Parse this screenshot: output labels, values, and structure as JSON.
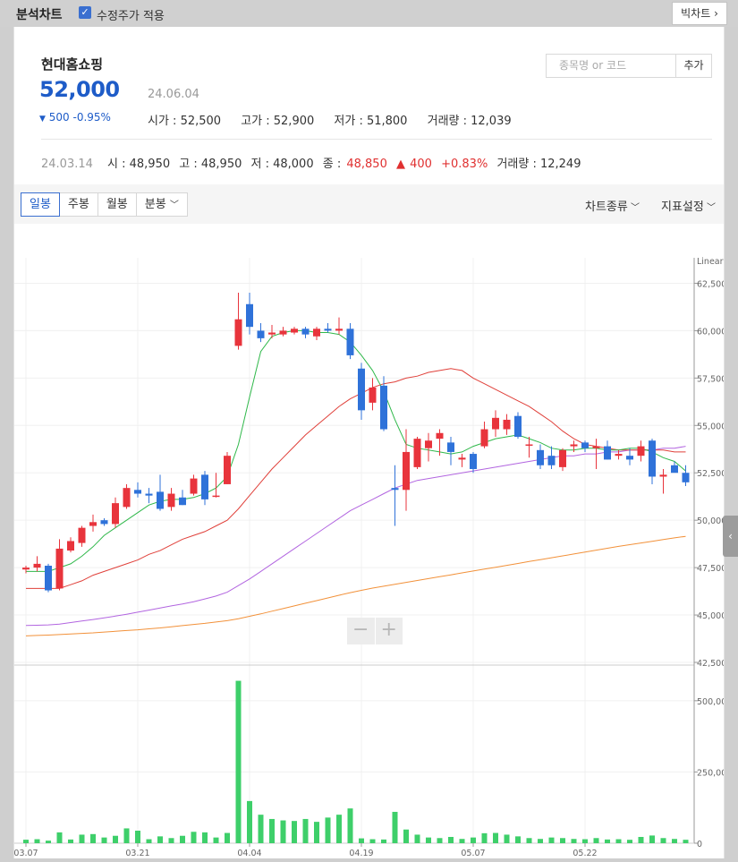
{
  "topbar": {
    "title": "분석차트",
    "adjusted_label": "수정주가 적용",
    "big_chart_label": "빅차트",
    "big_chart_arrow": "›"
  },
  "quote": {
    "name": "현대홈쇼핑",
    "price": "52,000",
    "date": "24.06.04",
    "change": "500",
    "change_pct": "-0.95%",
    "change_marker": "▼",
    "open": "시가 : 52,500",
    "high": "고가 : 52,900",
    "low": "저가 : 51,800",
    "volume": "거래량 : 12,039"
  },
  "search": {
    "placeholder": "종목명 or 코드",
    "add_label": "추가"
  },
  "prev_day": {
    "date": "24.03.14",
    "open": "시 : 48,950",
    "high": "고 : 48,950",
    "low": "저 : 48,000",
    "close_label": "종 :",
    "close": "48,850",
    "change": "400",
    "change_marker": "▲",
    "change_pct": "+0.83%",
    "volume": "거래량 : 12,249"
  },
  "toolbar": {
    "tabs": [
      "일봉",
      "주봉",
      "월봉",
      "분봉"
    ],
    "active_tab": "일봉",
    "chart_type": "차트종류",
    "indicator": "지표설정"
  },
  "zoom": {
    "minus": "−",
    "plus": "+"
  },
  "side_handle": "‹",
  "colors": {
    "up": "#e8343c",
    "down": "#2f72d9",
    "ma5": "#2fb84a",
    "ma20": "#e0403a",
    "ma60": "#b265e0",
    "ma120": "#f2913a",
    "volume": "#3ecf6a"
  },
  "chart_data": {
    "type": "candlestick",
    "scale": "Linear",
    "price_ylim": [
      42500,
      63750
    ],
    "price_ticks": [
      "62,500",
      "60,000",
      "57,500",
      "55,000",
      "52,500",
      "50,000",
      "47,500",
      "45,000",
      "42,500"
    ],
    "volume_ylim": [
      0,
      600000
    ],
    "volume_ticks": [
      "500,000",
      "250,000",
      "0"
    ],
    "x_ticks": [
      {
        "label": "03.07",
        "index": 0
      },
      {
        "label": "03.21",
        "index": 10
      },
      {
        "label": "04.04",
        "index": 20
      },
      {
        "label": "04.19",
        "index": 30
      },
      {
        "label": "05.07",
        "index": 40
      },
      {
        "label": "05.22",
        "index": 50
      }
    ],
    "ohlc": [
      [
        47400,
        47600,
        47200,
        47500
      ],
      [
        47500,
        48100,
        47300,
        47700
      ],
      [
        47600,
        47700,
        46200,
        46300
      ],
      [
        46400,
        49000,
        46300,
        48500
      ],
      [
        48400,
        49100,
        48300,
        48900
      ],
      [
        48800,
        49700,
        48600,
        49600
      ],
      [
        49700,
        50300,
        49400,
        49900
      ],
      [
        50000,
        50100,
        49700,
        49800
      ],
      [
        49800,
        51200,
        49600,
        50900
      ],
      [
        50700,
        51900,
        50600,
        51700
      ],
      [
        51600,
        52000,
        51200,
        51400
      ],
      [
        51400,
        51700,
        50900,
        51300
      ],
      [
        51500,
        52400,
        50500,
        50600
      ],
      [
        50700,
        51700,
        50500,
        51400
      ],
      [
        51200,
        51600,
        50800,
        50800
      ],
      [
        51400,
        52400,
        51300,
        52200
      ],
      [
        52400,
        52600,
        50800,
        51100
      ],
      [
        51300,
        52500,
        51200,
        51300
      ],
      [
        51900,
        53600,
        51900,
        53400
      ],
      [
        59200,
        62000,
        59000,
        60600
      ],
      [
        61400,
        62000,
        59800,
        60200
      ],
      [
        60000,
        60400,
        59400,
        59600
      ],
      [
        59800,
        60300,
        59600,
        59900
      ],
      [
        59800,
        60200,
        59700,
        60000
      ],
      [
        59900,
        60200,
        59800,
        60100
      ],
      [
        60100,
        60200,
        59600,
        59800
      ],
      [
        59700,
        60200,
        59500,
        60100
      ],
      [
        60100,
        60400,
        59900,
        60000
      ],
      [
        60000,
        60700,
        59800,
        60100
      ],
      [
        60100,
        60400,
        58500,
        58700
      ],
      [
        58000,
        58300,
        55300,
        55800
      ],
      [
        56200,
        57500,
        55800,
        57000
      ],
      [
        57100,
        57600,
        54700,
        54800
      ],
      [
        51700,
        52900,
        49700,
        51600
      ],
      [
        51600,
        54800,
        50500,
        53600
      ],
      [
        52800,
        54400,
        52700,
        54300
      ],
      [
        53800,
        54600,
        53100,
        54200
      ],
      [
        54300,
        54800,
        53400,
        54600
      ],
      [
        54100,
        54400,
        52900,
        53600
      ],
      [
        53200,
        53500,
        52800,
        53300
      ],
      [
        53500,
        53600,
        52500,
        52700
      ],
      [
        53900,
        55200,
        53800,
        54800
      ],
      [
        54800,
        55800,
        54400,
        55400
      ],
      [
        54800,
        55600,
        54500,
        55300
      ],
      [
        55500,
        55700,
        54300,
        54400
      ],
      [
        54000,
        54400,
        53300,
        54000
      ],
      [
        53700,
        54000,
        52700,
        52900
      ],
      [
        53400,
        53900,
        52700,
        52900
      ],
      [
        52800,
        53800,
        52600,
        53700
      ],
      [
        53900,
        54200,
        53600,
        54000
      ],
      [
        54100,
        54200,
        53600,
        53800
      ],
      [
        53800,
        54300,
        52700,
        53900
      ],
      [
        53900,
        54200,
        53200,
        53200
      ],
      [
        53400,
        53700,
        53200,
        53500
      ],
      [
        53400,
        53800,
        52900,
        53200
      ],
      [
        53400,
        54200,
        53100,
        53900
      ],
      [
        54200,
        54300,
        51900,
        52300
      ],
      [
        52300,
        52700,
        51400,
        52400
      ],
      [
        52900,
        53100,
        52600,
        52500
      ],
      [
        52500,
        52900,
        51800,
        52000
      ]
    ],
    "volume": [
      12249,
      14000,
      9000,
      38000,
      13000,
      30000,
      32000,
      20000,
      26000,
      52000,
      44000,
      14000,
      24000,
      18000,
      26000,
      40000,
      38000,
      20000,
      36000,
      570000,
      148000,
      100000,
      85000,
      80000,
      78000,
      85000,
      75000,
      90000,
      100000,
      122000,
      17000,
      14000,
      13000,
      110000,
      48000,
      30000,
      20000,
      18000,
      22000,
      15000,
      20000,
      35000,
      36000,
      30000,
      24000,
      18000,
      15000,
      20000,
      18000,
      15000,
      14000,
      18000,
      13000,
      14000,
      12000,
      22000,
      27000,
      18000,
      15000,
      12039
    ],
    "ma5": [
      47300,
      47300,
      47300,
      47500,
      47700,
      48100,
      48600,
      49200,
      49600,
      50000,
      50400,
      50800,
      51000,
      51100,
      51100,
      51200,
      51400,
      51700,
      52300,
      54000,
      56500,
      58900,
      59700,
      59900,
      60000,
      60000,
      59900,
      59900,
      59800,
      59400,
      58700,
      57900,
      56800,
      55300,
      54000,
      53800,
      53700,
      53600,
      53500,
      53600,
      53900,
      54100,
      54300,
      54400,
      54500,
      54300,
      54100,
      53800,
      53700,
      53700,
      53800,
      53800,
      53700,
      53700,
      53800,
      53800,
      53600,
      53300,
      53100,
      52600
    ],
    "ma20": [
      46400,
      46400,
      46400,
      46400,
      46600,
      46800,
      47100,
      47300,
      47500,
      47700,
      47900,
      48200,
      48400,
      48700,
      49000,
      49200,
      49400,
      49700,
      50000,
      50600,
      51300,
      52000,
      52700,
      53300,
      53900,
      54500,
      55000,
      55500,
      56000,
      56400,
      56700,
      57000,
      57200,
      57300,
      57500,
      57600,
      57800,
      57900,
      58000,
      57900,
      57500,
      57200,
      56900,
      56600,
      56300,
      56000,
      55600,
      55200,
      54700,
      54300,
      54000,
      53900,
      53800,
      53700,
      53700,
      53700,
      53700,
      53700,
      53600,
      53600
    ],
    "ma60": [
      44450,
      44460,
      44480,
      44520,
      44600,
      44680,
      44760,
      44850,
      44940,
      45040,
      45150,
      45260,
      45370,
      45480,
      45580,
      45700,
      45850,
      46000,
      46200,
      46550,
      46900,
      47300,
      47700,
      48100,
      48500,
      48900,
      49300,
      49700,
      50100,
      50500,
      50800,
      51100,
      51400,
      51700,
      51900,
      52100,
      52200,
      52300,
      52400,
      52500,
      52600,
      52700,
      52800,
      52900,
      53000,
      53100,
      53200,
      53300,
      53400,
      53400,
      53500,
      53500,
      53600,
      53600,
      53700,
      53700,
      53700,
      53800,
      53800,
      53900
    ],
    "ma120": [
      43900,
      43920,
      43940,
      43970,
      44000,
      44030,
      44060,
      44100,
      44140,
      44180,
      44220,
      44270,
      44320,
      44380,
      44440,
      44500,
      44560,
      44630,
      44700,
      44800,
      44930,
      45060,
      45200,
      45340,
      45480,
      45620,
      45760,
      45900,
      46040,
      46180,
      46300,
      46420,
      46520,
      46620,
      46720,
      46820,
      46920,
      47020,
      47120,
      47220,
      47320,
      47420,
      47520,
      47620,
      47720,
      47820,
      47920,
      48020,
      48120,
      48220,
      48320,
      48420,
      48520,
      48620,
      48710,
      48800,
      48890,
      48980,
      49070,
      49150
    ]
  }
}
